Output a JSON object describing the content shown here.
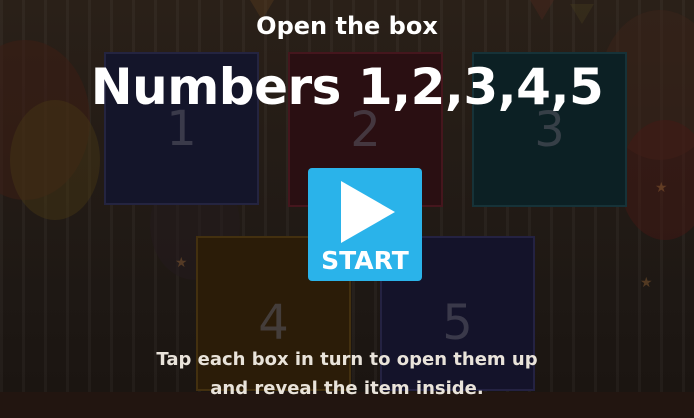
{
  "title": "Open the box",
  "headline": "Numbers 1,2,3,4,5",
  "start_button": {
    "label": "START",
    "icon": "play-icon"
  },
  "instructions": "Tap each box in turn to open them up and reveal the item inside.",
  "boxes": [
    {
      "number": "1",
      "color": "#14152a",
      "border": "#242440"
    },
    {
      "number": "2",
      "color": "#2a0f12",
      "border": "#45161d"
    },
    {
      "number": "3",
      "color": "#0c2024",
      "border": "#163238"
    },
    {
      "number": "4",
      "color": "#2b1c08",
      "border": "#43300f"
    },
    {
      "number": "5",
      "color": "#14132a",
      "border": "#242242"
    }
  ],
  "colors": {
    "accent": "#2ab3ea",
    "text": "#ffffff",
    "background": "#1c1612"
  }
}
